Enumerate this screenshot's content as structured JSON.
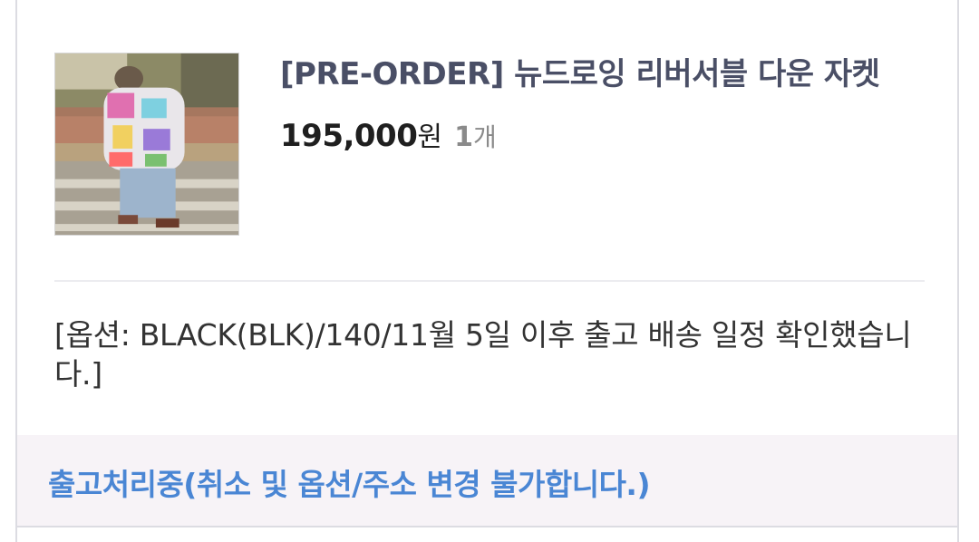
{
  "product": {
    "title": "[PRE-ORDER] 뉴드로잉 리버서블 다운 자켓",
    "price": "195,000",
    "price_unit": "원",
    "quantity": "1",
    "quantity_unit": "개",
    "image_icon": "product-photo"
  },
  "option_text": "[옵션: BLACK(BLK)/140/11월 5일 이후 출고 배송 일정 확인했습니다.]",
  "status": {
    "text": "출고처리중(취소 및 옵션/주소 변경 불가합니다.)",
    "color": "#4a86d4"
  }
}
